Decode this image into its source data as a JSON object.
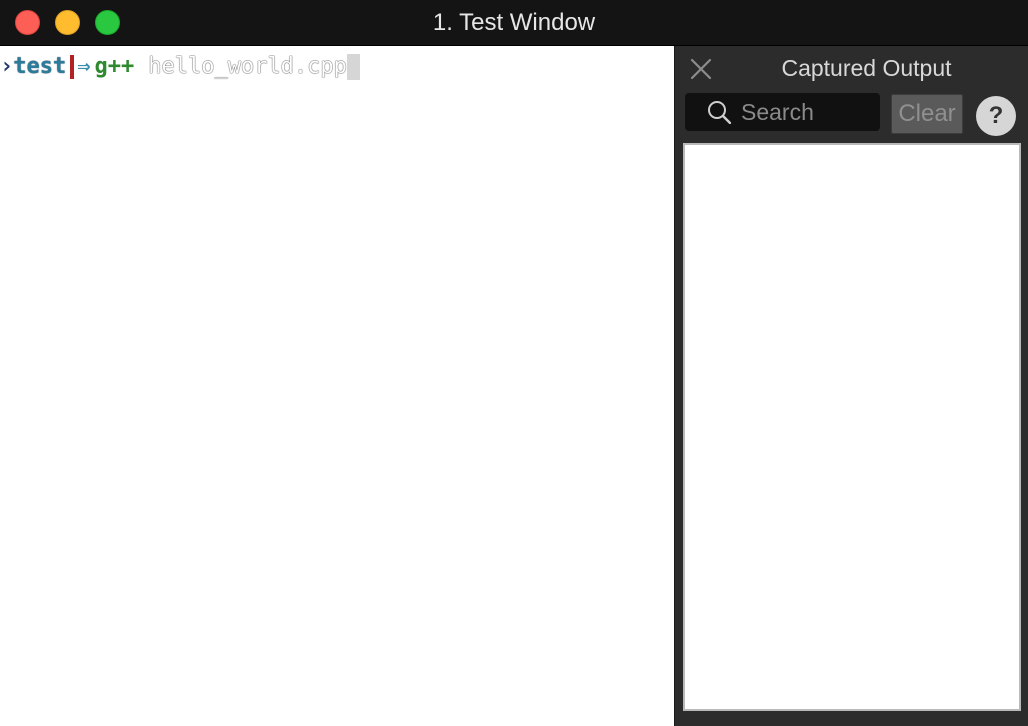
{
  "window": {
    "title": "1. Test Window"
  },
  "terminal": {
    "prompt_arrow": "›",
    "directory": "test",
    "prompt_symbol": "⇒",
    "command": "g++",
    "argument": "hello_world.cpp"
  },
  "panel": {
    "title": "Captured Output",
    "search_placeholder": "Search",
    "search_value": "",
    "clear_label": "Clear",
    "help_label": "?"
  },
  "icons": {
    "close": "close-icon",
    "search": "search-icon"
  },
  "colors": {
    "titlebar": "#141414",
    "panel_bg": "#2c2c2c",
    "dir": "#2a7c9a",
    "command": "#2f8a2f",
    "separator": "#b22222"
  }
}
